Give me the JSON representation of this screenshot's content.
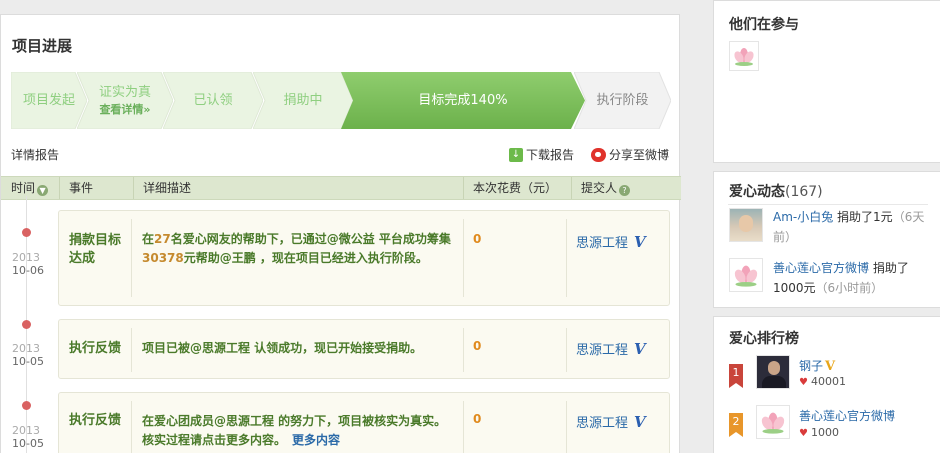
{
  "progress": {
    "title": "项目进展",
    "steps": [
      {
        "label": "项目发起"
      },
      {
        "label": "证实为真",
        "sub": "查看详情»"
      },
      {
        "label": "已认领"
      },
      {
        "label": "捐助中"
      },
      {
        "label": "目标完成140%"
      },
      {
        "label": "执行阶段"
      }
    ],
    "detail_report": "详情报告",
    "download_report": "下载报告",
    "share_weibo": "分享至微博"
  },
  "table": {
    "headers": {
      "time": "时间",
      "event": "事件",
      "desc": "详细描述",
      "cost": "本次花费（元）",
      "submitter": "提交人"
    },
    "rows": [
      {
        "year": "2013",
        "date": "10-06",
        "event": "捐款目标达成",
        "desc_a": "在",
        "desc_num1": "27",
        "desc_b": "名爱心网友的帮助下，已通过@微公益 平台成功筹集",
        "desc_num2": "30378",
        "desc_c": "元帮助@王鹏 ，现在项目已经进入执行阶段。",
        "cost": "0",
        "submitter": "思源工程"
      },
      {
        "year": "2013",
        "date": "10-05",
        "event": "执行反馈",
        "desc": "项目已被@思源工程 认领成功，现已开始接受捐助。",
        "cost": "0",
        "submitter": "思源工程"
      },
      {
        "year": "2013",
        "date": "10-05",
        "event": "执行反馈",
        "desc": "在爱心团成员@思源工程 的努力下，项目被核实为真实。核实过程请点击更多内容。",
        "more": "更多内容",
        "cost": "0",
        "submitter": "思源工程"
      }
    ]
  },
  "sidebar": {
    "participants": {
      "title": "他们在参与"
    },
    "feed": {
      "title": "爱心动态",
      "count": "(167)",
      "items": [
        {
          "user": "Am-小白兔",
          "action": " 捐助了1元",
          "time": "（6天前）"
        },
        {
          "user": "善心莲心官方微博",
          "action": " 捐助了1000元",
          "time": "（6小时前）"
        }
      ]
    },
    "ranking": {
      "title": "爱心排行榜",
      "items": [
        {
          "rank": "1",
          "name": "钢子",
          "score": "40001"
        },
        {
          "rank": "2",
          "name": "善心莲心官方微博",
          "score": "1000"
        }
      ]
    }
  },
  "colors": {
    "done": "#e8f3df",
    "active": "#7cc15c",
    "todo": "#f0f0f0",
    "link": "#2b6aa8",
    "accent_orange": "#e08a1e"
  }
}
